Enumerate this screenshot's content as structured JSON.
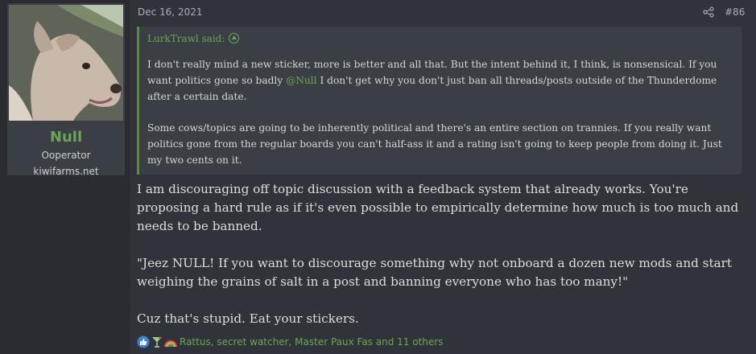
{
  "user": {
    "name": "Null",
    "title": "Ooperator",
    "extra": "kiwifarms.net"
  },
  "post": {
    "date": "Dec 16, 2021",
    "number": "#86",
    "quote": {
      "author_label": "LurkTrawl said:",
      "paragraph1_before": "I don't really mind a new sticker, more is better and all that. But the intent behind it, I think, is nonsensical. If you want politics gone so badly ",
      "mention": "@Null",
      "paragraph1_after": " I don't get why you don't just ban all threads/posts outside of the Thunderdome after a certain date.",
      "paragraph2": "Some cows/topics are going to be inherently political and there's an entire section on trannies. If you really want politics gone from the regular boards you can't half-ass it and a rating isn't going to keep people from doing it. Just my two cents on it."
    },
    "body": [
      "I am discouraging off topic discussion with a feedback system that already works. You're proposing a hard rule as if it's even possible to empirically determine how much is too much and needs to be banned.",
      "\"Jeez NULL! If you want to discourage something why not onboard a dozen new mods and start weighing the grains of salt in a post and banning everyone who has too many!\"",
      "Cuz that's stupid. Eat your stickers."
    ],
    "reactions": {
      "icons": [
        "like-icon",
        "cocktail-icon",
        "rainbow-icon"
      ],
      "text": "Rattus, secret watcher, Master Paux Fas and 11 others"
    }
  },
  "colors": {
    "accent": "#6aa84f",
    "background": "#30333a",
    "quote_background": "#3a3e45"
  }
}
